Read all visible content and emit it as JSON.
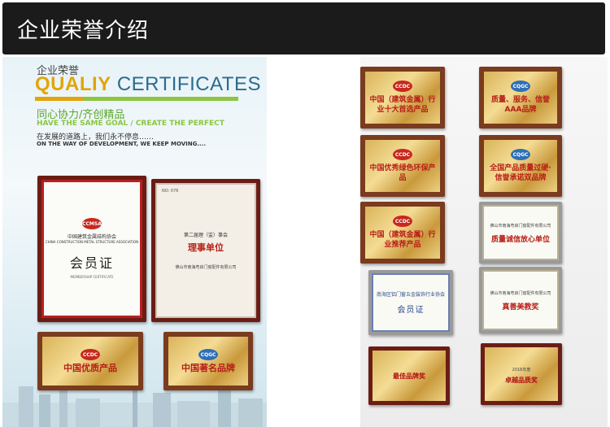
{
  "header": {
    "title": "企业荣誉介绍"
  },
  "intro": {
    "small_cn": "企业荣誉",
    "title_q": "QUALIY",
    "title_rest": " CERTIFICATES",
    "slogan_cn": "同心协力/齐创精品",
    "slogan_en": "HAVE THE SAME GOAL / CREATE THE PERFECT",
    "way_cn": "在发展的道路上，我们永不停息……",
    "way_en": "ON THE WAY OF DEVELOPMENT, WE KEEP MOVING...."
  },
  "certs": {
    "ccmsa": {
      "seal": "CCMSA",
      "org": "中国建筑金属结构协会",
      "org_en": "CHINA CONSTRUCTION METAL STRUCTURE ASSOCIATION",
      "title": "会员证",
      "subtitle": "MEMBERSHIP CERTIFICATE"
    },
    "nanhai": {
      "no": "NO: 076",
      "session": "第二届理（监）事会",
      "role": "理事单位",
      "company": "佛山市南海粤启门窗配件有限公司"
    },
    "ccdc1": {
      "seal": "CCDC",
      "text": "中国优质产品"
    },
    "cqgc1": {
      "seal": "CQGC",
      "text": "中国著名品牌"
    },
    "r1": {
      "seal": "CCDC",
      "text": "中国（建筑金属）行业十大首选产品"
    },
    "r2": {
      "seal": "CQGC",
      "text": "质量、服务、信誉AAA品牌"
    },
    "r3": {
      "seal": "CCDC",
      "text": "中国优秀绿色环保产品"
    },
    "r4": {
      "seal": "CQGC",
      "text": "全国产品质量过硬·信誉承诺双品牌"
    },
    "r5": {
      "seal": "CCDC",
      "text": "中国（建筑金属）行业推荐产品"
    },
    "r6": {
      "company": "佛山市南海粤启门窗配件有限公司",
      "text": "质量诚信放心单位"
    },
    "r7": {
      "text": "南海区铝门窗五金装饰行业协会",
      "title": "会员证"
    },
    "r8": {
      "company": "佛山市南海粤启门窗配件有限公司",
      "text": "真善美教奖"
    },
    "r9": {
      "text": "最佳品牌奖"
    },
    "r10": {
      "year": "2016年度",
      "text": "卓越品质奖"
    }
  }
}
